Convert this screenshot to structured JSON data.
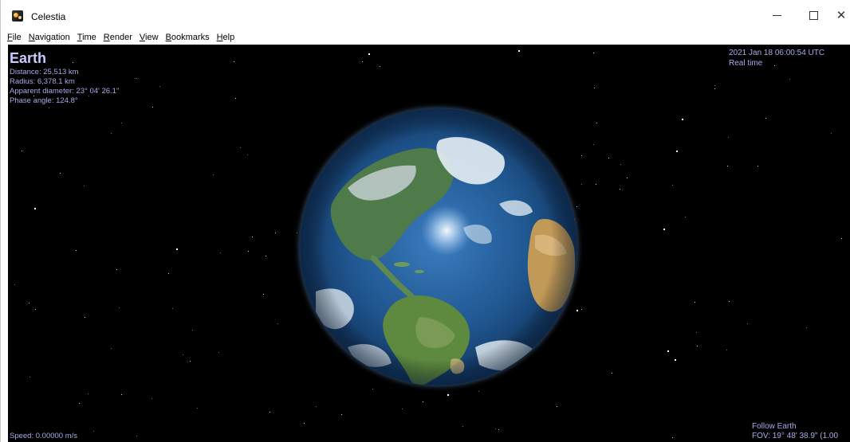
{
  "window": {
    "title": "Celestia",
    "minimize_glyph": "—",
    "close_glyph": "✕"
  },
  "menu": {
    "items": [
      {
        "label": "File",
        "mnemonic": "F",
        "rest": "ile"
      },
      {
        "label": "Navigation",
        "mnemonic": "N",
        "rest": "avigation"
      },
      {
        "label": "Time",
        "mnemonic": "T",
        "rest": "ime"
      },
      {
        "label": "Render",
        "mnemonic": "R",
        "rest": "ender"
      },
      {
        "label": "View",
        "mnemonic": "V",
        "rest": "iew"
      },
      {
        "label": "Bookmarks",
        "mnemonic": "B",
        "rest": "ookmarks"
      },
      {
        "label": "Help",
        "mnemonic": "H",
        "rest": "elp"
      }
    ]
  },
  "hud": {
    "object_name": "Earth",
    "distance": "Distance: 25,513 km",
    "radius": "Radius: 6,378.1 km",
    "apparent_diameter": "Apparent diameter: 23° 04' 26.1\"",
    "phase_angle": "Phase angle: 124.8°",
    "datetime": "2021 Jan 18 06:00:54 UTC",
    "time_mode": "Real time",
    "speed": "Speed: 0.00000 m/s",
    "follow": "Follow Earth",
    "fov": "FOV: 19° 48' 38.9\" (1.00"
  },
  "colors": {
    "hud_text": "#a7acea",
    "sky": "#000000"
  },
  "icons": {
    "app": "celestia-app-icon",
    "minimize": "minimize-icon",
    "maximize": "maximize-icon",
    "close": "close-icon"
  }
}
